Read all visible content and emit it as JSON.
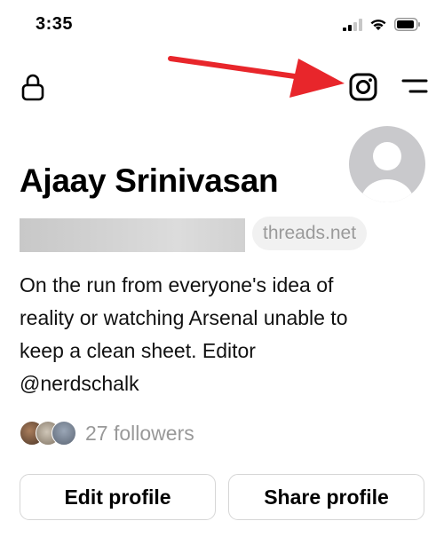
{
  "status_bar": {
    "time": "3:35",
    "icons": [
      "cellular-signal-icon",
      "wifi-icon",
      "battery-icon"
    ]
  },
  "top_bar": {
    "left_icon": "lock-icon",
    "right_icons": [
      "instagram-icon",
      "menu-icon"
    ],
    "annotation": "red-arrow-pointing-to-instagram-icon"
  },
  "profile": {
    "name": "Ajaay Srinivasan",
    "username": "",
    "domain_badge": "threads.net",
    "bio": [
      "On the run from everyone's idea of",
      "reality or watching Arsenal unable to",
      "keep a clean sheet. Editor",
      "@nerdschalk"
    ],
    "followers_label": "27 followers"
  },
  "actions": {
    "edit_label": "Edit profile",
    "share_label": "Share profile"
  },
  "colors": {
    "arrow": "#e8262b",
    "muted_text": "#999999",
    "button_border": "#d6d6d6",
    "badge_bg": "#f1f1f1",
    "avatar_bg": "#c9c9cc"
  }
}
